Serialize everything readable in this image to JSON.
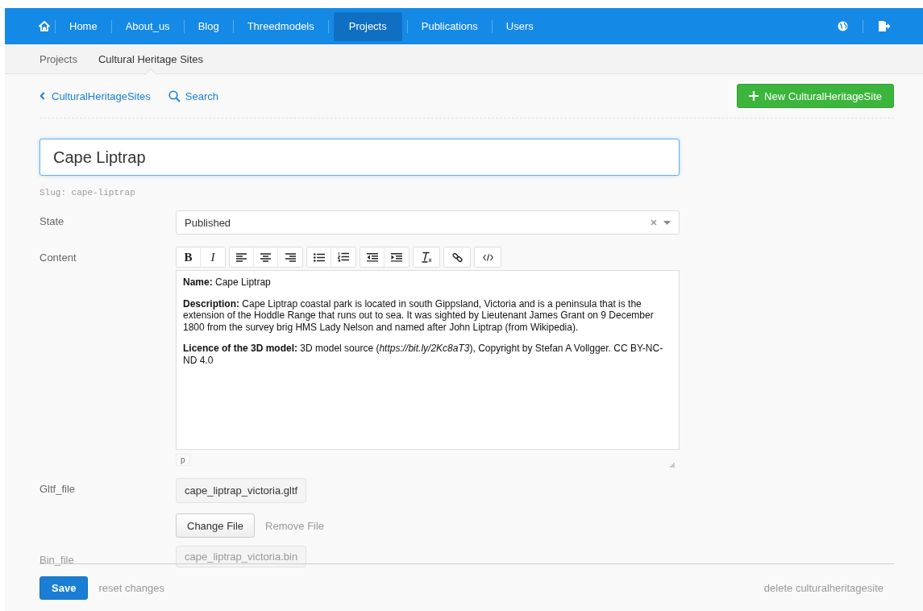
{
  "nav": {
    "items": [
      {
        "label": "Home",
        "selected": false
      },
      {
        "label": "About_us",
        "selected": false
      },
      {
        "label": "Blog",
        "selected": false
      },
      {
        "label": "Threedmodels",
        "selected": false
      },
      {
        "label": "Projects",
        "selected": true
      },
      {
        "label": "Publications",
        "selected": false
      },
      {
        "label": "Users",
        "selected": false
      }
    ]
  },
  "breadcrumbs": [
    {
      "label": "Projects",
      "selected": false
    },
    {
      "label": "Cultural Heritage Sites",
      "selected": true
    }
  ],
  "list_toolbar": {
    "back_link": "CulturalHeritageSites",
    "search_link": "Search",
    "new_button": "New CulturalHeritageSite"
  },
  "title_field": {
    "value": "Cape Liptrap"
  },
  "slug": "Slug: cape-liptrap",
  "state": {
    "label": "State",
    "value": "Published"
  },
  "content": {
    "label": "Content",
    "toolbar": [
      [
        {
          "kind": "bold",
          "label": "B"
        },
        {
          "kind": "italic",
          "label": "I"
        }
      ],
      [
        {
          "kind": "align-left"
        },
        {
          "kind": "align-center"
        },
        {
          "kind": "align-right"
        }
      ],
      [
        {
          "kind": "bullet-list"
        },
        {
          "kind": "numbered-list"
        }
      ],
      [
        {
          "kind": "outdent"
        },
        {
          "kind": "indent"
        }
      ],
      [
        {
          "kind": "clear-format"
        }
      ],
      [
        {
          "kind": "link"
        }
      ],
      [
        {
          "kind": "code"
        }
      ]
    ],
    "paragraphs": [
      "**Name:** Cape Liptrap",
      "**Description:** Cape Liptrap coastal park is located in south Gippsland, Victoria and is a peninsula that is the extension of the Hoddle Range that runs out to sea. It was sighted by Lieutenant James Grant on 9 December 1800 from the survey brig HMS Lady Nelson and named after John Liptrap (from Wikipedia).",
      "**Licence of the 3D model:** 3D model source (*https://bit.ly/2Kc8aT3*), Copyright by Stefan A Vollgger. CC BY-NC-ND 4.0"
    ],
    "path": "p"
  },
  "files": [
    {
      "label": "Gltf_file",
      "filename": "cape_liptrap_victoria.gltf",
      "change": "Change File",
      "remove": "Remove File"
    },
    {
      "label": "Bin_file",
      "filename": "cape_liptrap_victoria.bin"
    }
  ],
  "footer": {
    "save": "Save",
    "reset": "reset changes",
    "delete": "delete culturalheritagesite"
  }
}
